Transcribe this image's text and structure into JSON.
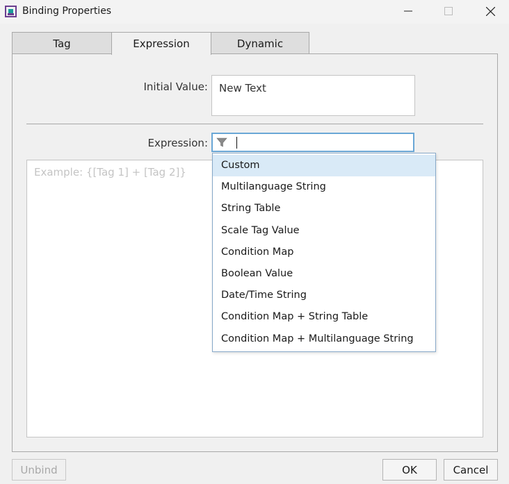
{
  "window": {
    "title": "Binding Properties",
    "app_icon": "app-logo-icon",
    "controls": [
      "minimize-icon",
      "maximize-icon",
      "close-icon"
    ]
  },
  "tabs": [
    {
      "label": "Tag",
      "active": false
    },
    {
      "label": "Expression",
      "active": true
    },
    {
      "label": "Dynamic",
      "active": false
    }
  ],
  "form": {
    "initial_value_label": "Initial Value:",
    "initial_value": "New Text",
    "expression_label": "Expression:",
    "expression_value": "",
    "expression_placeholder": "Example: {[Tag 1] + [Tag 2]}"
  },
  "dropdown": {
    "items": [
      "Custom",
      "Multilanguage String",
      "String Table",
      "Scale Tag Value",
      "Condition Map",
      "Boolean Value",
      "Date/Time String",
      "Condition Map + String Table",
      "Condition Map + Multilanguage String"
    ],
    "selected": "Custom"
  },
  "buttons": {
    "unbind": "Unbind",
    "ok": "OK",
    "cancel": "Cancel"
  },
  "colors": {
    "accent_border": "#6aa7d6",
    "selected_item_bg": "#d9eaf7",
    "icon_teal": "#1a9a9a",
    "icon_purple": "#6a3d8f"
  }
}
